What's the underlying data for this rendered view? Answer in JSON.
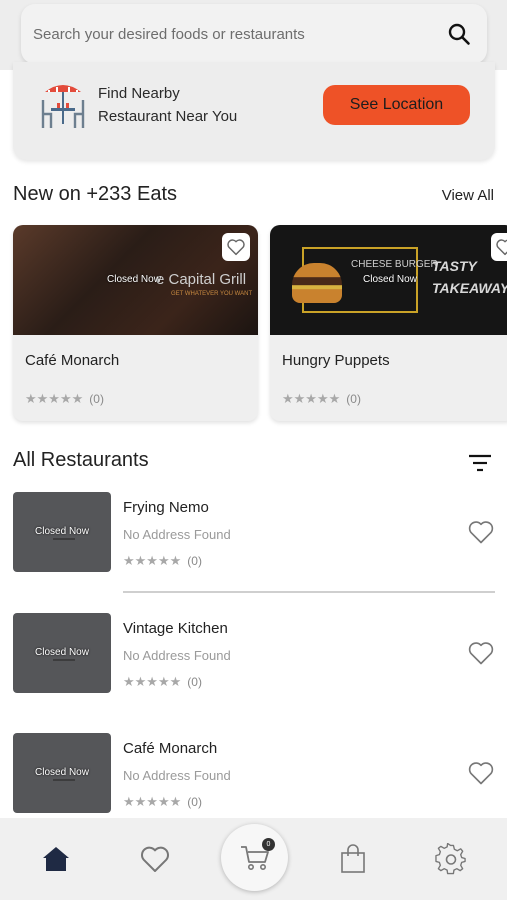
{
  "search": {
    "placeholder": "Search your desired foods or restaurants"
  },
  "nearby": {
    "line1": "Find Nearby",
    "line2": "Restaurant Near You",
    "button_label": "See Location"
  },
  "new_section": {
    "title": "New on +233 Eats",
    "view_all": "View All",
    "cards": [
      {
        "name": "Café Monarch",
        "status": "Closed Now",
        "banner_text": "e Capital Grill",
        "banner_sub": "GET WHATEVER YOU WANT",
        "stars": "★★★★★",
        "rating_count": "(0)"
      },
      {
        "name": "Hungry Puppets",
        "status": "Closed Now",
        "banner_text": "CHEESE BURGER",
        "banner_sub": "TASTY TAKEAWAYS",
        "stars": "★★★★★",
        "rating_count": "(0)"
      }
    ]
  },
  "all_section": {
    "title": "All Restaurants",
    "items": [
      {
        "name": "Frying Nemo",
        "address": "No Address Found",
        "status": "Closed Now",
        "stars": "★★★★★",
        "rating_count": "(0)"
      },
      {
        "name": "Vintage Kitchen",
        "address": "No Address Found",
        "status": "Closed Now",
        "stars": "★★★★★",
        "rating_count": "(0)"
      },
      {
        "name": "Café Monarch",
        "address": "No Address Found",
        "status": "Closed Now",
        "stars": "★★★★★",
        "rating_count": "(0)"
      }
    ]
  },
  "bottom_nav": {
    "items": [
      "home-icon",
      "heart-icon",
      "cart-icon",
      "bag-icon",
      "settings-icon"
    ],
    "cart_badge": "0"
  },
  "colors": {
    "accent": "#ee5227",
    "thumb": "#555659"
  }
}
